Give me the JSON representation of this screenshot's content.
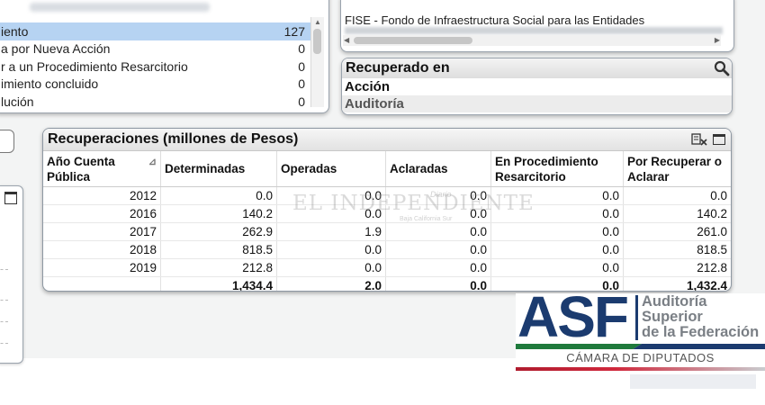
{
  "left_list": {
    "rows": [
      {
        "label": "iento",
        "count": "127",
        "selected": true
      },
      {
        "label": "a por Nueva Acción",
        "count": "0"
      },
      {
        "label": "r a un Procedimiento Resarcitorio",
        "count": "0"
      },
      {
        "label": "imiento concluido",
        "count": "0"
      },
      {
        "label": "lución",
        "count": "0"
      }
    ]
  },
  "fondos_list": {
    "line1": "FISE - Fondo de Infraestructura Social para las Entidades"
  },
  "recuperado_en": {
    "title": "Recuperado en",
    "items": [
      "Acción",
      "Auditoría"
    ]
  },
  "table": {
    "title": "Recuperaciones (millones de Pesos)",
    "headers": [
      "Año Cuenta Pública",
      "Determinadas",
      "Operadas",
      "Aclaradas",
      "En Procedimiento Resarcitorio",
      "Por Recuperar o Aclarar"
    ],
    "rows": [
      [
        "2012",
        "0.0",
        "0.0",
        "0.0",
        "0.0",
        "0.0"
      ],
      [
        "2016",
        "140.2",
        "0.0",
        "0.0",
        "0.0",
        "140.2"
      ],
      [
        "2017",
        "262.9",
        "1.9",
        "0.0",
        "0.0",
        "261.0"
      ],
      [
        "2018",
        "818.5",
        "0.0",
        "0.0",
        "0.0",
        "818.5"
      ],
      [
        "2019",
        "212.8",
        "0.0",
        "0.0",
        "0.0",
        "212.8"
      ]
    ],
    "totals": [
      "",
      "1,434.4",
      "2.0",
      "0.0",
      "0.0",
      "1,432.4"
    ]
  },
  "watermark": {
    "main": "EL INDEPENDIENTE",
    "tag": "Diario",
    "sub": "Baja California Sur"
  },
  "logo": {
    "acronym": "ASF",
    "line1": "Auditoría",
    "line2": "Superior",
    "line3": "de la Federación",
    "chamber": "CÁMARA DE DIPUTADOS"
  },
  "colors": {
    "selection": "#b6d3f2",
    "asf_blue": "#1b3b6f",
    "mexico_green": "#1f7a3c",
    "mexico_red": "#c0283a"
  }
}
